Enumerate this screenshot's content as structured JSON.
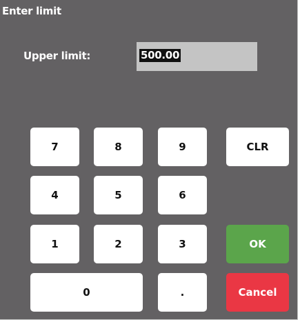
{
  "dialog": {
    "title": "Enter limit",
    "field_label": "Upper limit:",
    "field_value": "500.00"
  },
  "keypad": {
    "k7": "7",
    "k8": "8",
    "k9": "9",
    "clr": "CLR",
    "k4": "4",
    "k5": "5",
    "k6": "6",
    "k1": "1",
    "k2": "2",
    "k3": "3",
    "ok": "OK",
    "k0": "0",
    "dot": ".",
    "cancel": "Cancel"
  },
  "colors": {
    "background": "#636163",
    "field": "#c4c4c4",
    "key": "#ffffff",
    "ok": "#5ba54b",
    "cancel": "#ea3744"
  }
}
